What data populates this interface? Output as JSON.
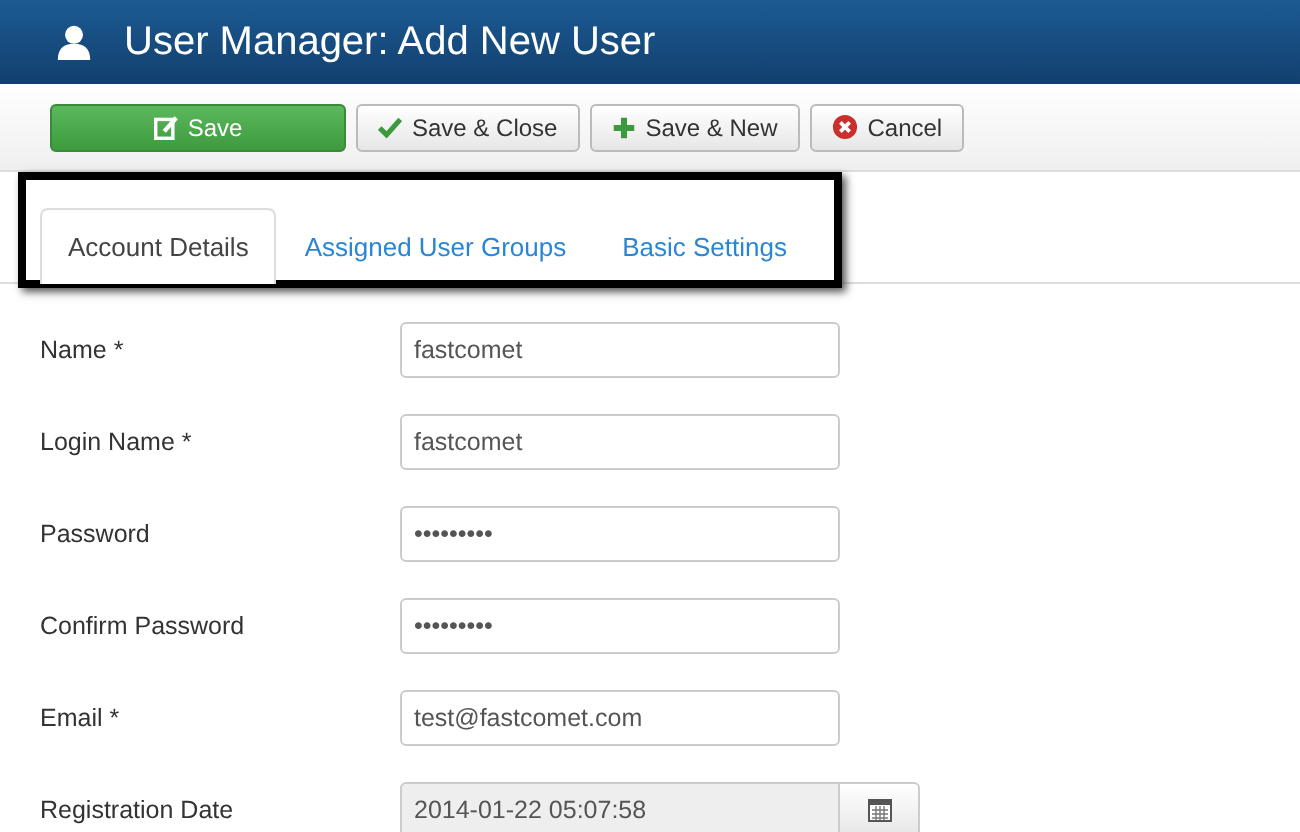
{
  "window": {
    "title": "User Manager: Add New User"
  },
  "toolbar": [
    {
      "label": "Save",
      "kind": "save"
    },
    {
      "label": "Save & Close",
      "kind": "check"
    },
    {
      "label": "Save & New",
      "kind": "plus"
    },
    {
      "label": "Cancel",
      "kind": "cancel"
    }
  ],
  "tabs": [
    {
      "label": "Account Details",
      "selected": true
    },
    {
      "label": "Assigned User Groups",
      "selected": false
    },
    {
      "label": "Basic Settings",
      "selected": false
    }
  ],
  "fields": [
    {
      "label": "Name *",
      "value": "fastcomet",
      "readonly": false,
      "kind": "text"
    },
    {
      "label": "Login Name *",
      "value": "fastcomet",
      "readonly": false,
      "kind": "text"
    },
    {
      "label": "Password",
      "value": "•••••••••",
      "readonly": false,
      "kind": "text"
    },
    {
      "label": "Confirm Password",
      "value": "•••••••••",
      "readonly": false,
      "kind": "text"
    },
    {
      "label": "Email *",
      "value": "test@fastcomet.com",
      "readonly": false,
      "kind": "text"
    },
    {
      "label": "Registration Date",
      "value": "2014-01-22 05:07:58",
      "readonly": true,
      "kind": "date"
    }
  ]
}
